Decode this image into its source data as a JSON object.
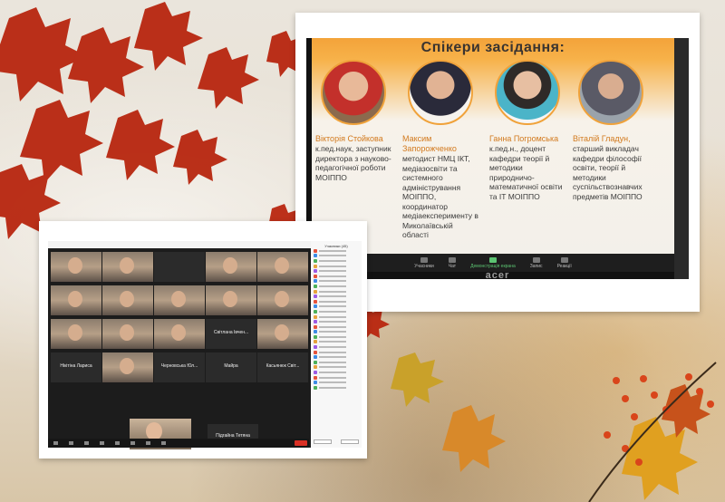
{
  "slide": {
    "title": "Спікери засідання:",
    "speakers": [
      {
        "name": "Вікторія Стойкова",
        "desc": "к.пед.наук, заступник директора з науково-педагогічної роботи МОІППО"
      },
      {
        "name": "Максим Запорожченко",
        "desc": "методист НМЦ ІКТ, медіазосвіти та системного адміністрування МОІППО, координатор медіаексперименту в Миколаївській області"
      },
      {
        "name": "Ганна Погромська",
        "desc": "к.пед.н., доцент кафедри теорії й методики природничо-математичної освіти та ІТ МОІППО"
      },
      {
        "name": "Віталій Гладун,",
        "desc": "старший викладач кафедри філософії освіти, теорії й методики суспільствознавчих предметів МОІППО"
      }
    ],
    "acer_logo": "acer",
    "zoom_controls": [
      "Учасники",
      "Чат",
      "Демонстрація екрана",
      "Запис",
      "Реакції"
    ]
  },
  "gallery": {
    "tiles": [
      "",
      "",
      "",
      "",
      "",
      "",
      "",
      "",
      "",
      "",
      "",
      "",
      "",
      "Світлана Івчен...",
      "",
      "Нікітіна Лариса",
      "",
      "Черновська Юл...",
      "Майра",
      "Касьянюк Світ..."
    ],
    "bottom_name": "Підгайна Тетяна",
    "participants_title": "Учасники (45)"
  },
  "colors": {
    "accent": "#f0a23a",
    "share": "#5cc472",
    "end": "#d93025"
  }
}
